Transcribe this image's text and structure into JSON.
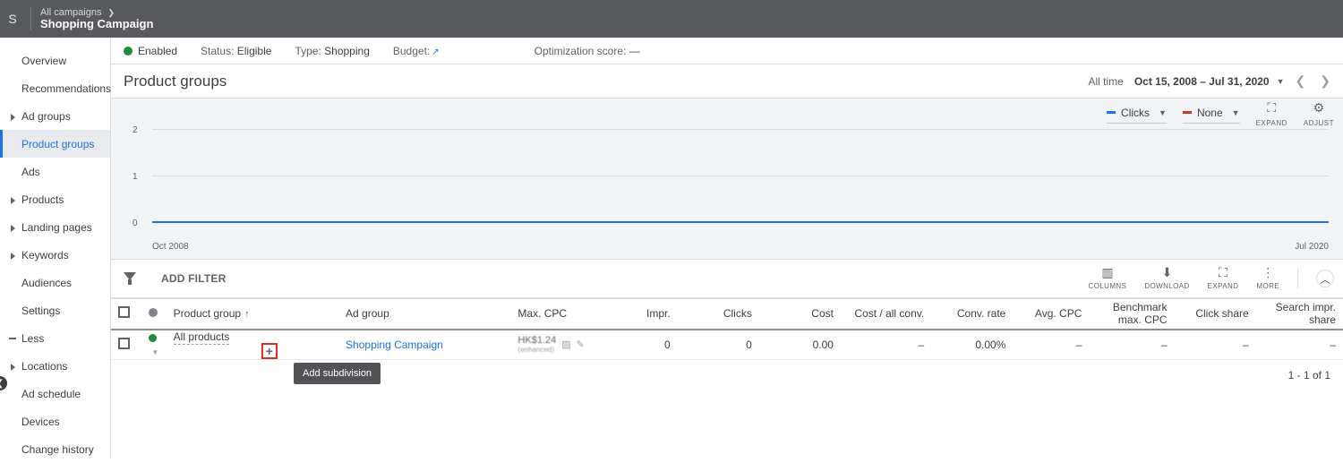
{
  "breadcrumb": {
    "parent": "All campaigns",
    "current": "Shopping Campaign"
  },
  "sidebar": {
    "items": [
      {
        "label": "Overview",
        "arrow": false
      },
      {
        "label": "Recommendations",
        "arrow": false
      },
      {
        "label": "Ad groups",
        "arrow": true
      },
      {
        "label": "Product groups",
        "arrow": false,
        "selected": true
      },
      {
        "label": "Ads",
        "arrow": false
      },
      {
        "label": "Products",
        "arrow": true
      },
      {
        "label": "Landing pages",
        "arrow": true
      },
      {
        "label": "Keywords",
        "arrow": true
      },
      {
        "label": "Audiences",
        "arrow": false
      },
      {
        "label": "Settings",
        "arrow": false
      }
    ],
    "less": "Less",
    "more_items": [
      {
        "label": "Locations",
        "arrow": true
      },
      {
        "label": "Ad schedule",
        "arrow": false
      },
      {
        "label": "Devices",
        "arrow": false
      },
      {
        "label": "Change history",
        "arrow": false
      }
    ]
  },
  "status": {
    "enabled": "Enabled",
    "status_lbl": "Status:",
    "status_val": "Eligible",
    "type_lbl": "Type:",
    "type_val": "Shopping",
    "budget_lbl": "Budget:",
    "opt_lbl": "Optimization score:",
    "opt_val": "—"
  },
  "title": "Product groups",
  "daterange": {
    "label": "All time",
    "value": "Oct 15, 2008 – Jul 31, 2020"
  },
  "metrics": {
    "primary": "Clicks",
    "secondary": "None",
    "expand": "EXPAND",
    "adjust": "ADJUST"
  },
  "chart_data": {
    "type": "line",
    "x": [
      "Oct 2008",
      "Jul 2020"
    ],
    "series": [
      {
        "name": "Clicks",
        "values": [
          0,
          0
        ]
      }
    ],
    "yticks": [
      0,
      1,
      2
    ],
    "ylim": [
      0,
      2
    ]
  },
  "filter": {
    "add": "ADD FILTER"
  },
  "tools": {
    "columns": "COLUMNS",
    "download": "DOWNLOAD",
    "expand": "EXPAND",
    "more": "MORE"
  },
  "table": {
    "headers": {
      "pg": "Product group",
      "ad": "Ad group",
      "cpc": "Max. CPC",
      "impr": "Impr.",
      "clicks": "Clicks",
      "cost": "Cost",
      "costconv": "Cost / all conv.",
      "convrate": "Conv. rate",
      "avgcpc": "Avg. CPC",
      "bench": "Benchmark max. CPC",
      "cshare": "Click share",
      "sis": "Search impr. share"
    },
    "row": {
      "pg": "All products",
      "ad": "Shopping Campaign",
      "cpc_main": "HK$1.24",
      "cpc_sub": "(enhanced)",
      "impr": "0",
      "clicks": "0",
      "cost": "0.00",
      "costconv": "–",
      "convrate": "0.00%",
      "avgcpc": "–",
      "bench": "–",
      "cshare": "–",
      "sis": "–"
    }
  },
  "tooltip": "Add subdivision",
  "pager": "1 - 1 of 1"
}
